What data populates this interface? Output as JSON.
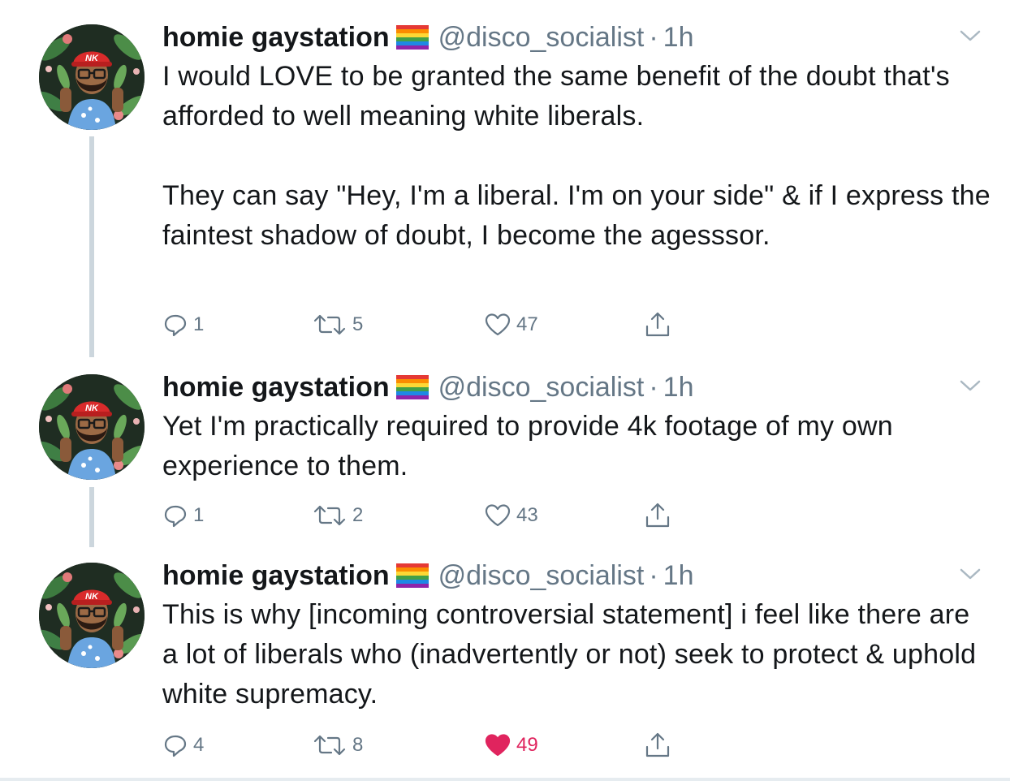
{
  "colors": {
    "text": "#14171a",
    "muted": "#657786",
    "like_active": "#e0245e",
    "thread_line": "#ccd6dd"
  },
  "tweets": [
    {
      "display_name": "homie gaystation",
      "flag_icon": "rainbow-flag-icon",
      "handle": "@disco_socialist",
      "separator": "·",
      "time": "1h",
      "body": [
        "I would LOVE to be granted the same benefit of the doubt that's afforded to well meaning white liberals.",
        "They can say \"Hey, I'm a liberal. I'm on your side\" & if I express the faintest shadow of doubt, I become the agesssor."
      ],
      "replies": "1",
      "retweets": "5",
      "likes": "47",
      "liked": false
    },
    {
      "display_name": "homie gaystation",
      "flag_icon": "rainbow-flag-icon",
      "handle": "@disco_socialist",
      "separator": "·",
      "time": "1h",
      "body": [
        "Yet I'm practically required to provide 4k footage of my own experience to them."
      ],
      "replies": "1",
      "retweets": "2",
      "likes": "43",
      "liked": false
    },
    {
      "display_name": "homie gaystation",
      "flag_icon": "rainbow-flag-icon",
      "handle": "@disco_socialist",
      "separator": "·",
      "time": "1h",
      "body": [
        "This is why [incoming controversial statement] i feel like there are a lot of liberals who (inadvertently or not) seek to protect & uphold white supremacy."
      ],
      "replies": "4",
      "retweets": "8",
      "likes": "49",
      "liked": true
    }
  ],
  "avatar": {
    "hat_text": "NK"
  }
}
